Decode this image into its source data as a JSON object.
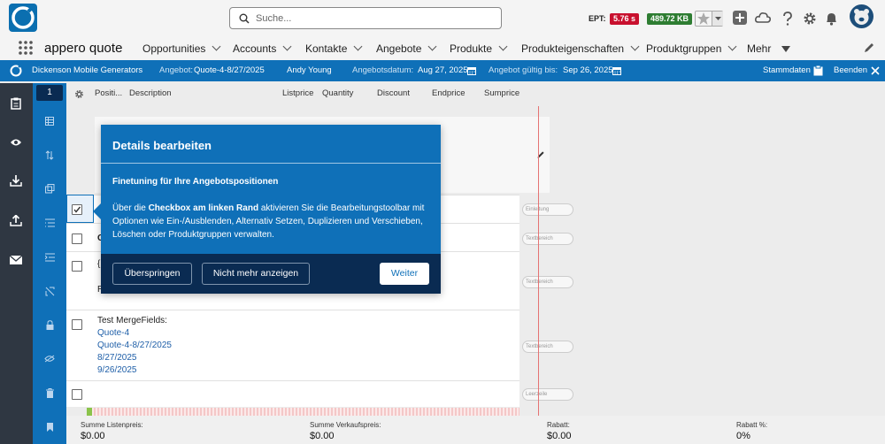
{
  "search": {
    "placeholder": "Suche..."
  },
  "header": {
    "ept_label": "EPT:",
    "ept_value": "5.76 s",
    "size_value": "489.72 KB",
    "colors": {
      "ept": "#c8102e",
      "size": "#2e7d32",
      "brand": "#0f70b8"
    }
  },
  "app": {
    "title": "appero quote"
  },
  "nav": {
    "items": [
      "Opportunities",
      "Accounts",
      "Kontakte",
      "Angebote",
      "Produkte",
      "Produkteigenschaften",
      "Produktgruppen"
    ],
    "more": "Mehr"
  },
  "quote_bar": {
    "account": "Dickenson Mobile Generators",
    "quote_label": "Angebot:",
    "quote_value": "Quote-4-8/27/2025",
    "owner": "Andy Young",
    "date_label": "Angebotsdatum:",
    "date_value": "Aug 27, 2025",
    "valid_label": "Angebot gültig bis:",
    "valid_value": "Sep 26, 2025",
    "stammdaten": "Stammdaten",
    "beenden": "Beenden"
  },
  "sidebar": {
    "badge": "1"
  },
  "table": {
    "columns": [
      "Positi...",
      "Description",
      "Listprice",
      "Quantity",
      "Discount",
      "Endprice",
      "Sumprice"
    ]
  },
  "rows": {
    "r2_char": "C",
    "r3_char1": "{",
    "r3_char2": "R",
    "merge_title": "Test MergeFields:",
    "merge_lines": [
      "Quote-4",
      "Quote-4-8/27/2025",
      "8/27/2025",
      "9/26/2025"
    ]
  },
  "pills": [
    "Einleitung",
    "Textbereich",
    "Textbereich",
    "Textbereich",
    "Leerzeile"
  ],
  "footer": {
    "labels": [
      "Summe Listenpreis:",
      "Summe Verkaufspreis:",
      "Rabatt:",
      "Rabatt %:"
    ],
    "values": [
      "$0.00",
      "$0.00",
      "$0.00",
      "0%"
    ]
  },
  "popup": {
    "title": "Details bearbeiten",
    "subtitle": "Finetuning für Ihre Angebotspositionen",
    "body_pre": "Über die ",
    "body_bold": "Checkbox am linken Rand",
    "body_post": " aktivieren Sie die Bearbeitungstoolbar mit Optionen wie Ein-/Ausblenden, Alternativ Setzen, Duplizieren und Verschieben, Löschen oder Produktgruppen verwalten.",
    "skip": "Überspringen",
    "never": "Nicht mehr anzeigen",
    "next": "Weiter"
  },
  "icons": [
    "search-icon",
    "star-icon",
    "plus-icon",
    "cloud-icon",
    "help-icon",
    "gear-icon",
    "bell-icon",
    "avatar-icon",
    "grid-icon",
    "pencil-icon",
    "calendar-icon",
    "close-icon",
    "clipboard-icon",
    "eye-icon",
    "download-icon",
    "upload-icon",
    "mail-icon"
  ]
}
